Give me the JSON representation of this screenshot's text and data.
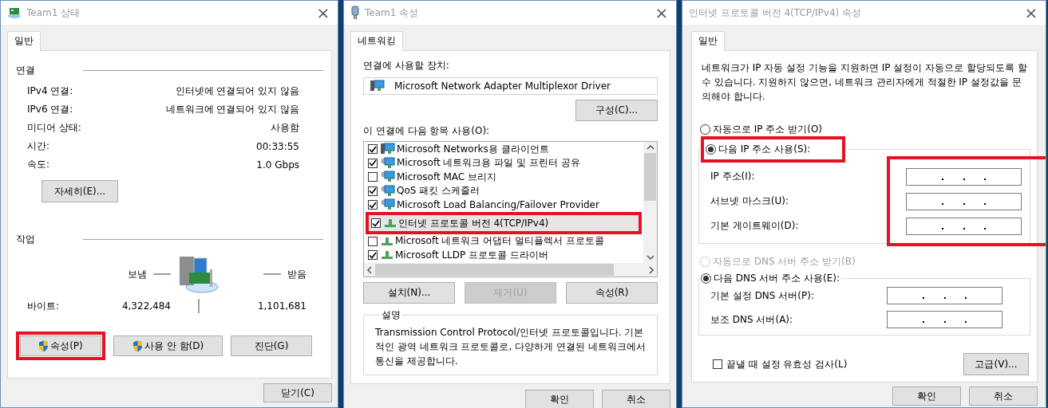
{
  "status_window": {
    "title": "Team1 상태",
    "close_label": "×",
    "tabs": [
      {
        "label": "일반",
        "selected": true
      }
    ],
    "connection": {
      "heading": "연결",
      "rows": [
        {
          "label": "IPv4 연결:",
          "value": "인터넷에 연결되어 있지 않음"
        },
        {
          "label": "IPv6 연결:",
          "value": "네트워크에 연결되어 있지 않음"
        },
        {
          "label": "미디어 상태:",
          "value": "사용함"
        },
        {
          "label": "시간:",
          "value": "00:33:55"
        },
        {
          "label": "속도:",
          "value": "1.0 Gbps"
        }
      ]
    },
    "details_button": "자세히(E)...",
    "activity": {
      "heading": "작업",
      "sent_label": "보냄",
      "received_label": "받음",
      "bytes_label": "바이트:",
      "bytes_sent": "4,322,484",
      "bytes_received": "1,101,681"
    },
    "buttons": [
      {
        "label": "속성(P)",
        "shield": true,
        "highlighted": true
      },
      {
        "label": "사용 안 함(D)",
        "shield": true,
        "highlighted": false
      },
      {
        "label": "진단(G)",
        "shield": false,
        "highlighted": false
      }
    ],
    "footer_buttons": [
      "닫기(C)"
    ]
  },
  "properties_window": {
    "title": "Team1 속성",
    "close_label": "×",
    "tabs": [
      {
        "label": "네트워킹",
        "selected": true
      }
    ],
    "device_label": "연결에 사용할 장치:",
    "device": "Microsoft Network Adapter Multiplexor Driver",
    "configure_button": "구성(C)...",
    "items_label": "이 연결에 다음 항목 사용(O):",
    "items": [
      {
        "label": "Microsoft Networks용 클라이언트",
        "kind": "client",
        "checked": true,
        "selected": false,
        "highlighted": false
      },
      {
        "label": "Microsoft 네트워크용 파일 및 프린터 공유",
        "kind": "service",
        "checked": true,
        "selected": false,
        "highlighted": false
      },
      {
        "label": "Microsoft MAC 브리지",
        "kind": "service",
        "checked": false,
        "selected": false,
        "highlighted": false
      },
      {
        "label": "QoS 패킷 스케줄러",
        "kind": "service",
        "checked": true,
        "selected": false,
        "highlighted": false
      },
      {
        "label": "Microsoft Load Balancing/Failover Provider",
        "kind": "service",
        "checked": true,
        "selected": false,
        "highlighted": false
      },
      {
        "label": "인터넷 프로토콜 버전 4(TCP/IPv4)",
        "kind": "protocol",
        "checked": true,
        "selected": true,
        "highlighted": true
      },
      {
        "label": "Microsoft 네트워크 어댑터 멀티플렉서 프로토콜",
        "kind": "protocol",
        "checked": false,
        "selected": false,
        "highlighted": false
      },
      {
        "label": "Microsoft LLDP 프로토콜 드라이버",
        "kind": "protocol",
        "checked": true,
        "selected": false,
        "highlighted": false
      }
    ],
    "buttons": [
      {
        "label": "설치(N)...",
        "disabled": false
      },
      {
        "label": "제거(U)",
        "disabled": true
      },
      {
        "label": "속성(R)",
        "disabled": false
      }
    ],
    "description": {
      "heading": "설명",
      "text": "Transmission Control Protocol/인터넷 프로토콜입니다. 기본적인 광역 네트워크 프로토콜로, 다양하게 연결된 네트워크에서 통신을 제공합니다."
    },
    "footer_buttons": [
      "확인",
      "취소"
    ]
  },
  "ipv4_window": {
    "title": "인터넷 프로토콜 버전 4(TCP/IPv4) 속성",
    "close_label": "×",
    "tabs": [
      {
        "label": "일반",
        "selected": true
      }
    ],
    "intro": "네트워크가 IP 자동 설정 기능을 지원하면 IP 설정이 자동으로 할당되도록 할 수 있습니다. 지원하지 않으면, 네트워크 관리자에게 적절한 IP 설정값을 문의해야 합니다.",
    "ip_options": [
      {
        "label": "자동으로 IP 주소 받기(O)",
        "selected": false,
        "disabled": false
      },
      {
        "label": "다음 IP 주소 사용(S):",
        "selected": true,
        "disabled": false,
        "highlighted": true
      }
    ],
    "ip_fields_highlighted": true,
    "ip_fields": [
      {
        "label": "IP 주소(I):"
      },
      {
        "label": "서브넷 마스크(U):"
      },
      {
        "label": "기본 게이트웨이(D):"
      }
    ],
    "dns_options": [
      {
        "label": "자동으로 DNS 서버 주소 받기(B)",
        "selected": false,
        "disabled": true
      },
      {
        "label": "다음 DNS 서버 주소 사용(E):",
        "selected": true,
        "disabled": false
      }
    ],
    "dns_fields": [
      {
        "label": "기본 설정 DNS 서버(P):"
      },
      {
        "label": "보조 DNS 서버(A):"
      }
    ],
    "validate": {
      "label": "끝낼 때 설정 유효성 검사(L)",
      "checked": false
    },
    "advanced_button": "고급(V)...",
    "footer_buttons": [
      "확인",
      "취소"
    ]
  }
}
